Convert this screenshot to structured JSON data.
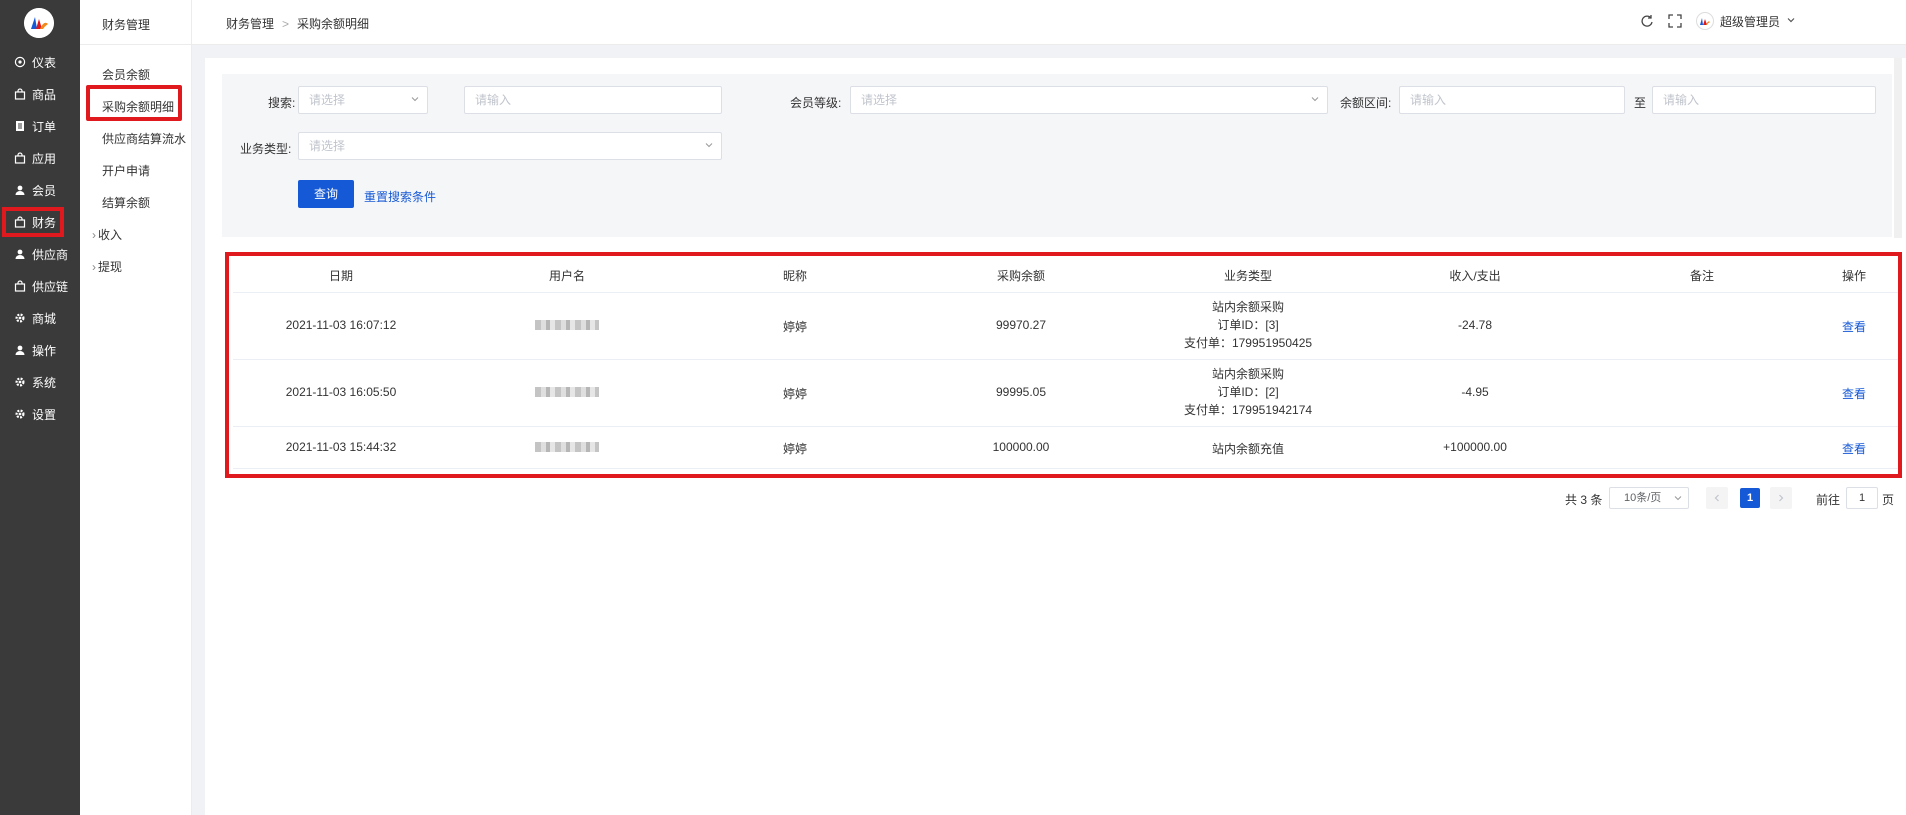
{
  "nav": {
    "items": [
      {
        "label": "仪表",
        "icon": "dashboard-icon"
      },
      {
        "label": "商品",
        "icon": "bag-icon"
      },
      {
        "label": "订单",
        "icon": "document-icon"
      },
      {
        "label": "应用",
        "icon": "bag-icon"
      },
      {
        "label": "会员",
        "icon": "user-icon"
      },
      {
        "label": "财务",
        "icon": "bag-icon",
        "active": true
      },
      {
        "label": "供应商",
        "icon": "user-icon"
      },
      {
        "label": "供应链",
        "icon": "bag-icon"
      },
      {
        "label": "商城",
        "icon": "gear-icon"
      },
      {
        "label": "操作",
        "icon": "user-icon"
      },
      {
        "label": "系统",
        "icon": "gear-icon"
      },
      {
        "label": "设置",
        "icon": "gear-icon"
      }
    ]
  },
  "subnav": {
    "title": "财务管理",
    "items": [
      "会员余额",
      "采购余额明细",
      "供应商结算流水",
      "开户申请",
      "结算余额"
    ],
    "groups": [
      "收入",
      "提现"
    ]
  },
  "header": {
    "breadcrumb": [
      "财务管理",
      "采购余额明细"
    ],
    "user": "超级管理员"
  },
  "filter": {
    "search_label": "搜索:",
    "search_select_placeholder": "请选择",
    "search_input_placeholder": "请输入",
    "level_label": "会员等级:",
    "level_placeholder": "请选择",
    "range_label": "余额区间:",
    "range_from_placeholder": "请输入",
    "range_sep": "至",
    "range_to_placeholder": "请输入",
    "type_label": "业务类型:",
    "type_placeholder": "请选择",
    "query_button": "查询",
    "reset_link": "重置搜索条件"
  },
  "table": {
    "columns": [
      "日期",
      "用户名",
      "昵称",
      "采购余额",
      "业务类型",
      "收入/支出",
      "备注",
      "操作"
    ],
    "rows": [
      {
        "date": "2021-11-03 16:07:12",
        "nickname": "婷婷",
        "balance": "99970.27",
        "type_lines": [
          "站内余额采购",
          "订单ID：[3]",
          "支付单：179951950425"
        ],
        "amount": "-24.78",
        "note": "",
        "action": "查看"
      },
      {
        "date": "2021-11-03 16:05:50",
        "nickname": "婷婷",
        "balance": "99995.05",
        "type_lines": [
          "站内余额采购",
          "订单ID：[2]",
          "支付单：179951942174"
        ],
        "amount": "-4.95",
        "note": "",
        "action": "查看"
      },
      {
        "date": "2021-11-03 15:44:32",
        "nickname": "婷婷",
        "balance": "100000.00",
        "type_lines": [
          "站内余额充值"
        ],
        "amount": "+100000.00",
        "note": "",
        "action": "查看"
      }
    ]
  },
  "pagination": {
    "total": "共 3 条",
    "page_size": "10条/页",
    "current": "1",
    "goto_label": "前往",
    "goto_value": "1",
    "page_suffix": "页"
  },
  "colors": {
    "primary": "#1659d6",
    "highlight": "#e0191e",
    "nav_bg": "#3a3a3a"
  }
}
